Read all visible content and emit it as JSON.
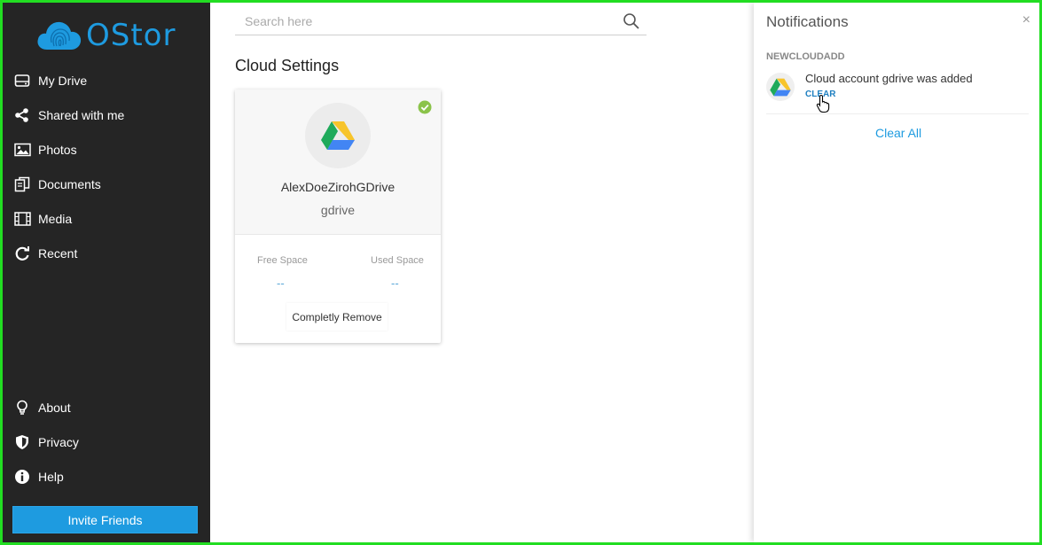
{
  "app": {
    "logo_text": "OStor",
    "brand_color": "#1e9be0"
  },
  "sidebar": {
    "items": [
      {
        "label": "My Drive",
        "icon": "drive-icon"
      },
      {
        "label": "Shared with me",
        "icon": "share-icon"
      },
      {
        "label": "Photos",
        "icon": "photos-icon"
      },
      {
        "label": "Documents",
        "icon": "documents-icon"
      },
      {
        "label": "Media",
        "icon": "media-icon"
      },
      {
        "label": "Recent",
        "icon": "recent-icon"
      }
    ],
    "bottom_items": [
      {
        "label": "About",
        "icon": "bulb-icon"
      },
      {
        "label": "Privacy",
        "icon": "shield-icon"
      },
      {
        "label": "Help",
        "icon": "info-icon"
      }
    ],
    "invite_label": "Invite Friends"
  },
  "search": {
    "placeholder": "Search here",
    "value": ""
  },
  "main": {
    "title": "Cloud Settings",
    "card": {
      "name": "AlexDoeZirohGDrive",
      "type": "gdrive",
      "free_space_label": "Free Space",
      "free_space_value": "--",
      "used_space_label": "Used Space",
      "used_space_value": "--",
      "remove_label": "Completly Remove",
      "status_color": "#8bc34a"
    }
  },
  "notifications": {
    "title": "Notifications",
    "close_symbol": "×",
    "group": "NEWCLOUDADD",
    "items": [
      {
        "message": "Cloud account gdrive was added",
        "action": "CLEAR"
      }
    ],
    "clear_all": "Clear All"
  }
}
